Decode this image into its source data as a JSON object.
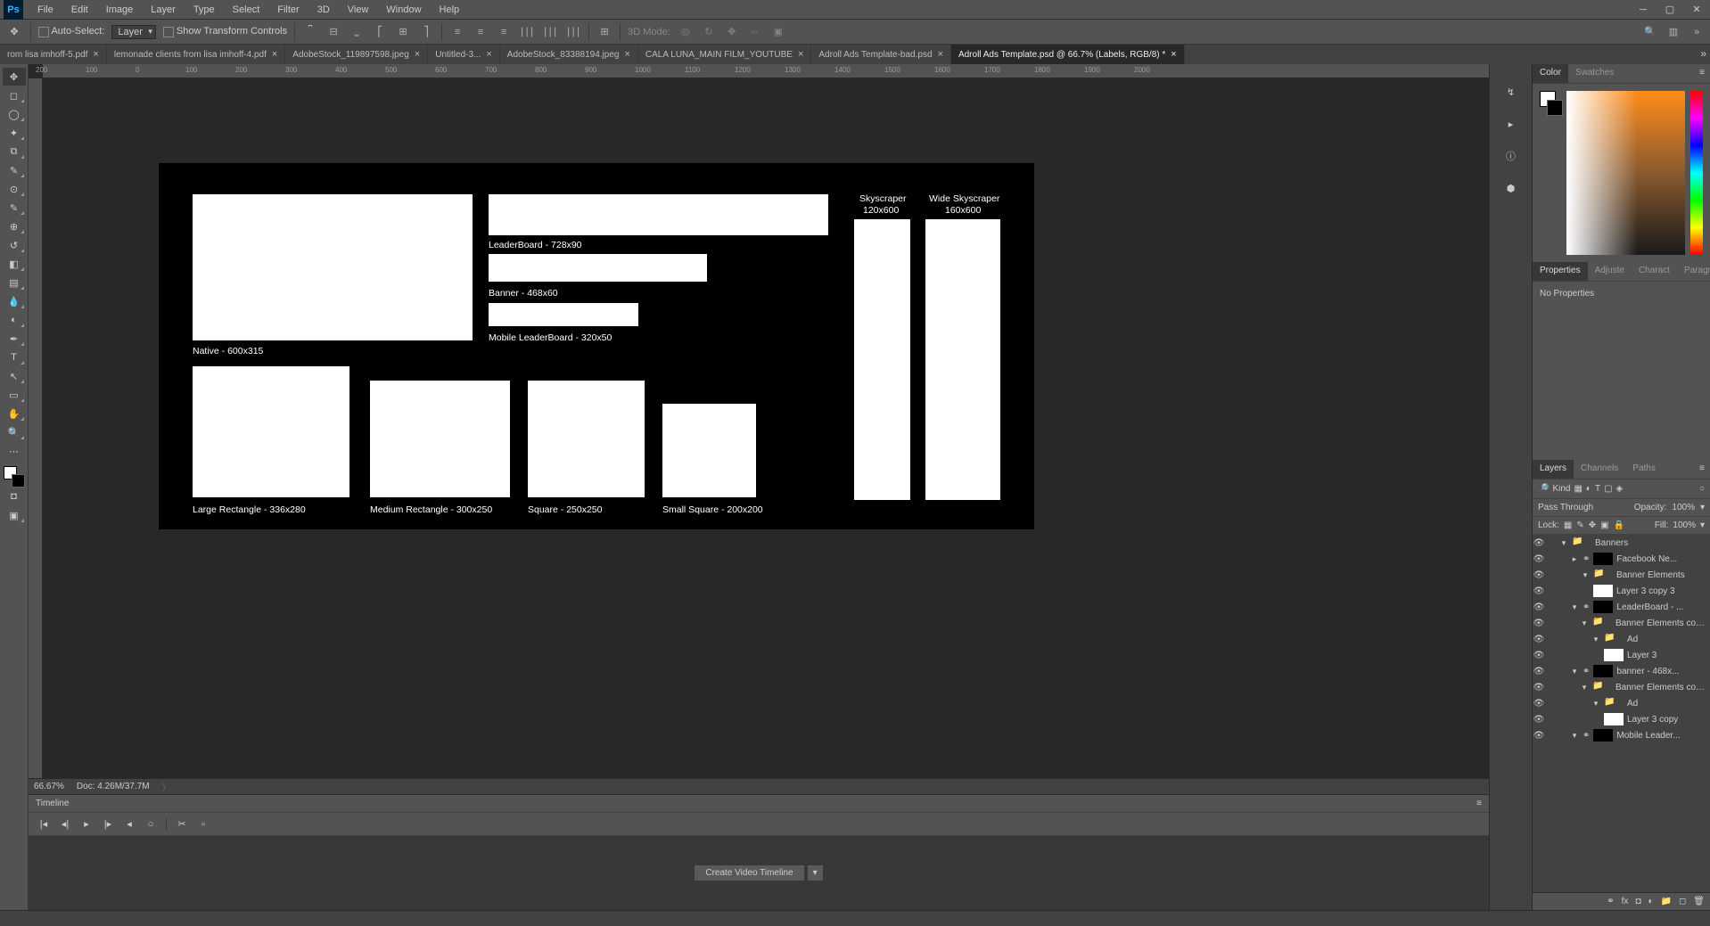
{
  "menu": [
    "File",
    "Edit",
    "Image",
    "Layer",
    "Type",
    "Select",
    "Filter",
    "3D",
    "View",
    "Window",
    "Help"
  ],
  "options": {
    "autoSelect": "Auto-Select:",
    "layerSel": "Layer",
    "showTransform": "Show Transform Controls",
    "threeD": "3D Mode:"
  },
  "tabs": [
    {
      "label": "rom lisa imhoff-5.pdf",
      "active": false
    },
    {
      "label": "lemonade clients from lisa imhoff-4.pdf",
      "active": false
    },
    {
      "label": "AdobeStock_119897598.jpeg",
      "active": false
    },
    {
      "label": "Untitled-3...",
      "active": false
    },
    {
      "label": "AdobeStock_83388194.jpeg",
      "active": false
    },
    {
      "label": "CALA LUNA_MAIN FILM_YOUTUBE",
      "active": false
    },
    {
      "label": "Adroll Ads Template-bad.psd",
      "active": false
    },
    {
      "label": "Adroll Ads Template.psd @ 66.7% (Labels, RGB/8) *",
      "active": true
    }
  ],
  "rulerMarks": [
    "200",
    "100",
    "0",
    "100",
    "200",
    "300",
    "400",
    "500",
    "600",
    "700",
    "800",
    "900",
    "1000",
    "1100",
    "1200",
    "1300",
    "1400",
    "1500",
    "1600",
    "1700",
    "1800",
    "1900",
    "2000"
  ],
  "canvas": {
    "labels": {
      "native": "Native - 600x315",
      "leader": "LeaderBoard - 728x90",
      "banner": "Banner - 468x60",
      "mobileLeader": "Mobile LeaderBoard - 320x50",
      "sky1": "Skyscraper",
      "sky1b": "120x600",
      "sky2": "Wide Skyscraper",
      "sky2b": "160x600",
      "lrect": "Large Rectangle - 336x280",
      "mrect": "Medium Rectangle - 300x250",
      "square": "Square - 250x250",
      "ssquare": "Small Square - 200x200"
    }
  },
  "status": {
    "zoom": "66.67%",
    "doc": "Doc: 4.26M/37.7M"
  },
  "timeline": {
    "title": "Timeline",
    "btn": "Create Video Timeline"
  },
  "panelTabs": {
    "color": [
      "Color",
      "Swatches"
    ],
    "props": [
      "Properties",
      "Adjuste",
      "Charact",
      "Paragra"
    ],
    "layers": [
      "Layers",
      "Channels",
      "Paths"
    ]
  },
  "propsBody": "No Properties",
  "layersOpts": {
    "kind": "Kind",
    "mode": "Pass Through",
    "opacityL": "Opacity:",
    "opacityV": "100%",
    "lockL": "Lock:",
    "fillL": "Fill:",
    "fillV": "100%"
  },
  "layers": [
    {
      "d": 0,
      "i": "folder",
      "n": "Banners",
      "tw": "▾"
    },
    {
      "d": 1,
      "i": "dark",
      "n": "Facebook Ne...",
      "tw": "▸",
      "link": true
    },
    {
      "d": 2,
      "i": "folder",
      "n": "Banner Elements",
      "tw": "▾"
    },
    {
      "d": 2,
      "i": "white",
      "n": "Layer 3 copy 3",
      "tw": ""
    },
    {
      "d": 1,
      "i": "dark",
      "n": "LeaderBoard - ...",
      "tw": "▾",
      "link": true
    },
    {
      "d": 2,
      "i": "folder",
      "n": "Banner Elements cop...",
      "tw": "▾"
    },
    {
      "d": 3,
      "i": "folder",
      "n": "Ad",
      "tw": "▾"
    },
    {
      "d": 3,
      "i": "white",
      "n": "Layer 3",
      "tw": ""
    },
    {
      "d": 1,
      "i": "dark",
      "n": "banner - 468x...",
      "tw": "▾",
      "link": true
    },
    {
      "d": 2,
      "i": "folder",
      "n": "Banner Elements cop...",
      "tw": "▾"
    },
    {
      "d": 3,
      "i": "folder",
      "n": "Ad",
      "tw": "▾"
    },
    {
      "d": 3,
      "i": "white",
      "n": "Layer 3 copy",
      "tw": ""
    },
    {
      "d": 1,
      "i": "dark",
      "n": "Mobile Leader...",
      "tw": "▾",
      "link": true
    }
  ]
}
